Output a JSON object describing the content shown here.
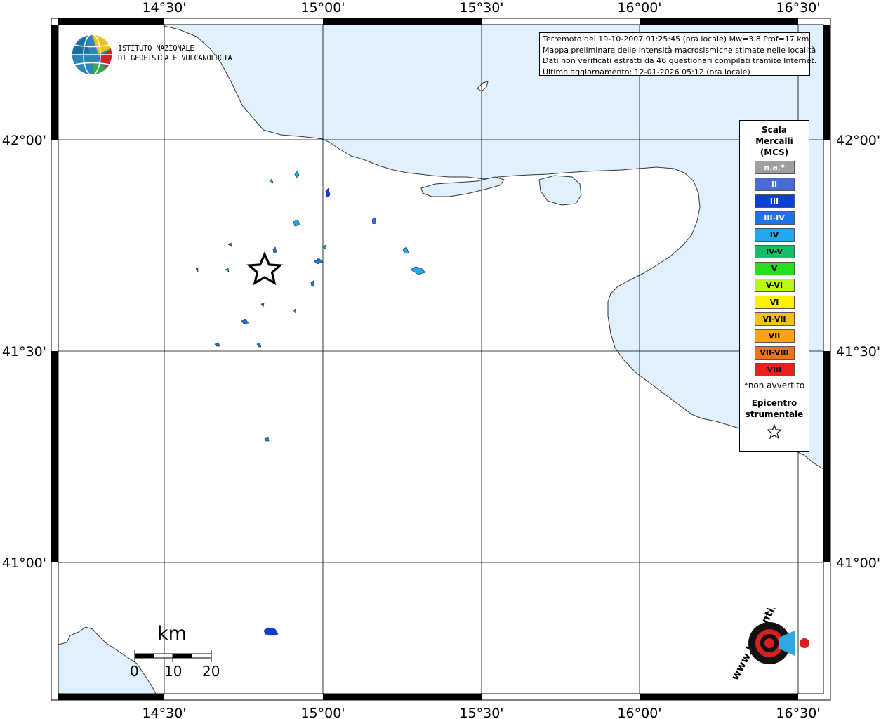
{
  "info": {
    "line1": "Terremoto del 19-10-2007 01:25:45 (ora locale) Mw=3.8 Prof=17 km",
    "line2": "Mappa preliminare delle intensità macrosismiche stimate nelle località",
    "line3": "Dati non verificati estratti da 46 questionari compilati tramite Internet.",
    "line4": "Ultimo aggiornamento: 12-01-2026 05:12 (ora locale)"
  },
  "axes": {
    "lon_labels": [
      "14°30'",
      "15°00'",
      "15°30'",
      "16°00'",
      "16°30'"
    ],
    "lat_labels": [
      "42°00'",
      "41°30'",
      "41°00'"
    ]
  },
  "institute": {
    "line1": "ISTITUTO NAZIONALE",
    "line2": "DI GEOFISICA E VULCANOLOGIA"
  },
  "legend": {
    "title1": "Scala",
    "title2": "Mercalli",
    "title3": "(MCS)",
    "items": [
      {
        "label": "n.a.*",
        "color": "#a0a0a0"
      },
      {
        "label": "II",
        "color": "#4a6bd0"
      },
      {
        "label": "III",
        "color": "#0a3fd8"
      },
      {
        "label": "III-IV",
        "color": "#1e74e6"
      },
      {
        "label": "IV",
        "color": "#22a8ef"
      },
      {
        "label": "IV-V",
        "color": "#12c06a"
      },
      {
        "label": "V",
        "color": "#22e020"
      },
      {
        "label": "V-VI",
        "color": "#bdf51a"
      },
      {
        "label": "VI",
        "color": "#fff200"
      },
      {
        "label": "VI-VII",
        "color": "#f4c01a"
      },
      {
        "label": "VII",
        "color": "#f8a418"
      },
      {
        "label": "VII-VIII",
        "color": "#f57318"
      },
      {
        "label": "VIII",
        "color": "#ee1f1a"
      }
    ],
    "footnote": "*non avvertito",
    "epicentre1": "Epicentro",
    "epicentre2": "strumentale",
    "star_icon": "star-outline-icon"
  },
  "scale_bar": {
    "unit": "km",
    "ticks": [
      "0",
      "10",
      "20"
    ]
  },
  "colors": {
    "sea": "#e0f0fc",
    "land": "#ffffff",
    "frame": "#000000"
  },
  "logos": {
    "ingv": "ingv-globe-logo",
    "hsit": "www.haisentitoilterremoto.it"
  }
}
